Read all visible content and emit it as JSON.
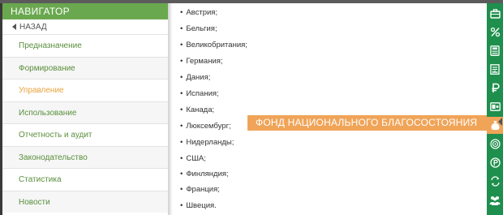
{
  "navigator": {
    "title": "НАВИГАТОР",
    "back_label": "НАЗАД",
    "items": [
      {
        "label": "Предназначение"
      },
      {
        "label": "Формирование"
      },
      {
        "label": "Управление",
        "active": true
      },
      {
        "label": "Использование"
      },
      {
        "label": "Отчетность и аудит"
      },
      {
        "label": "Законодательство"
      },
      {
        "label": "Статистика"
      },
      {
        "label": "Новости"
      }
    ]
  },
  "countries": [
    "Австрия;",
    "Бельгия;",
    "Великобритания;",
    "Германия;",
    "Дания;",
    "Испания;",
    "Канада;",
    "Люксембург;",
    "Нидерланды;",
    "США;",
    "Финляндия;",
    "Франция;",
    "Швеция."
  ],
  "bullet": "•",
  "active_section_label": "ФОНД НАЦИОНАЛЬНОГО БЛАГОСОСТОЯНИЯ",
  "rail_icons": [
    "briefcase-icon",
    "percent-icon",
    "calculator-icon",
    "document-chart-icon",
    "ruble-icon",
    "card-icon",
    "money-bag-icon",
    "target-icon",
    "coin-ruble-icon",
    "exchange-icon",
    "people-icon"
  ],
  "colors": {
    "brand_green": "#6aa84f",
    "rail_green": "#1f8f4d",
    "accent_orange": "#f0a458",
    "active_item": "#e8a33d"
  }
}
